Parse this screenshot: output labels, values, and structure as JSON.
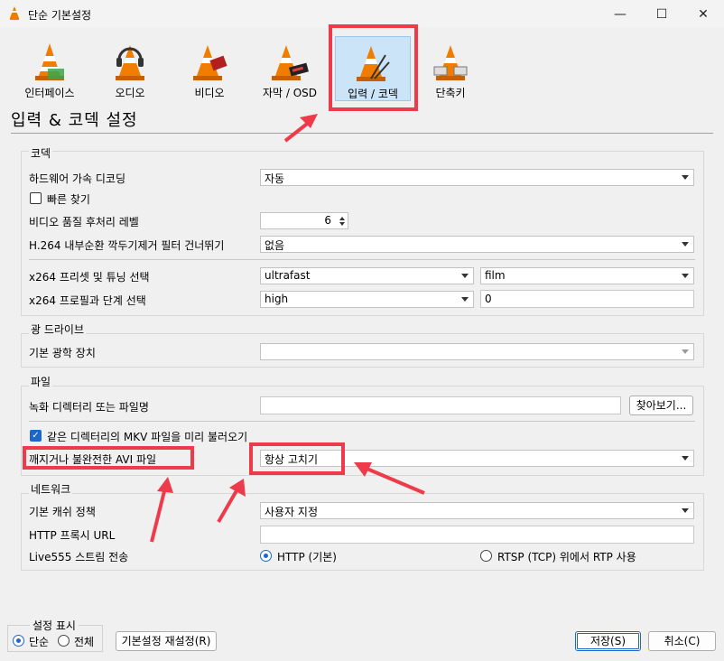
{
  "window": {
    "title": "단순 기본설정",
    "minimize": "—",
    "maximize": "☐",
    "close": "✕"
  },
  "categories": [
    {
      "label": "인터페이스",
      "icon": "cone-interface-icon"
    },
    {
      "label": "오디오",
      "icon": "cone-headphones-icon"
    },
    {
      "label": "비디오",
      "icon": "cone-video-icon"
    },
    {
      "label": "자막 / OSD",
      "icon": "cone-subtitles-icon"
    },
    {
      "label": "입력 / 코덱",
      "icon": "cone-input-codec-icon",
      "selected": true
    },
    {
      "label": "단축키",
      "icon": "cone-hotkeys-icon"
    }
  ],
  "page_title": "입력 & 코덱 설정",
  "codecs": {
    "title": "코덱",
    "hw_decoding": {
      "label": "하드웨어 가속 디코딩",
      "value": "자동"
    },
    "fast_seek": {
      "label": "빠른 찾기",
      "checked": false
    },
    "postproc": {
      "label": "비디오 품질 후처리 레벨",
      "value": "6"
    },
    "h264_skip": {
      "label": "H.264 내부순환 깍두기제거 필터 건너뛰기",
      "value": "없음"
    },
    "x264_preset": {
      "label": "x264 프리셋 및 튜닝 선택",
      "preset": "ultrafast",
      "tune": "film"
    },
    "x264_profile": {
      "label": "x264 프로필과 단계 선택",
      "profile": "high",
      "level": "0"
    }
  },
  "optical": {
    "title": "광 드라이브",
    "default_device": {
      "label": "기본 광학 장치",
      "value": ""
    }
  },
  "files": {
    "title": "파일",
    "record_dir": {
      "label": "녹화 디렉터리 또는 파일명",
      "value": "",
      "browse": "찾아보기..."
    },
    "preload_mkv": {
      "label": "같은 디렉터리의 MKV 파일을 미리 불러오기",
      "checked": true
    },
    "avi_fix": {
      "label": "깨지거나 불완전한 AVI 파일",
      "value": "항상 고치기"
    }
  },
  "network": {
    "title": "네트워크",
    "cache_policy": {
      "label": "기본 캐쉬 정책",
      "value": "사용자 지정"
    },
    "http_proxy": {
      "label": "HTTP 프록시 URL",
      "value": ""
    },
    "live555": {
      "label": "Live555 스트림 전송",
      "opt_http": "HTTP (기본)",
      "opt_rtsp": "RTSP (TCP) 위에서 RTP 사용",
      "selected": "http"
    }
  },
  "footer": {
    "show_settings": "설정 표시",
    "simple": "단순",
    "all": "전체",
    "mode_selected": "simple",
    "reset": "기본설정 재설정(R)",
    "save": "저장(S)",
    "cancel": "취소(C)"
  },
  "colors": {
    "accent": "#1e66c8",
    "highlight": "#ee3b4c",
    "selected_bg": "#cce4f7",
    "cone_orange": "#f07c00"
  }
}
